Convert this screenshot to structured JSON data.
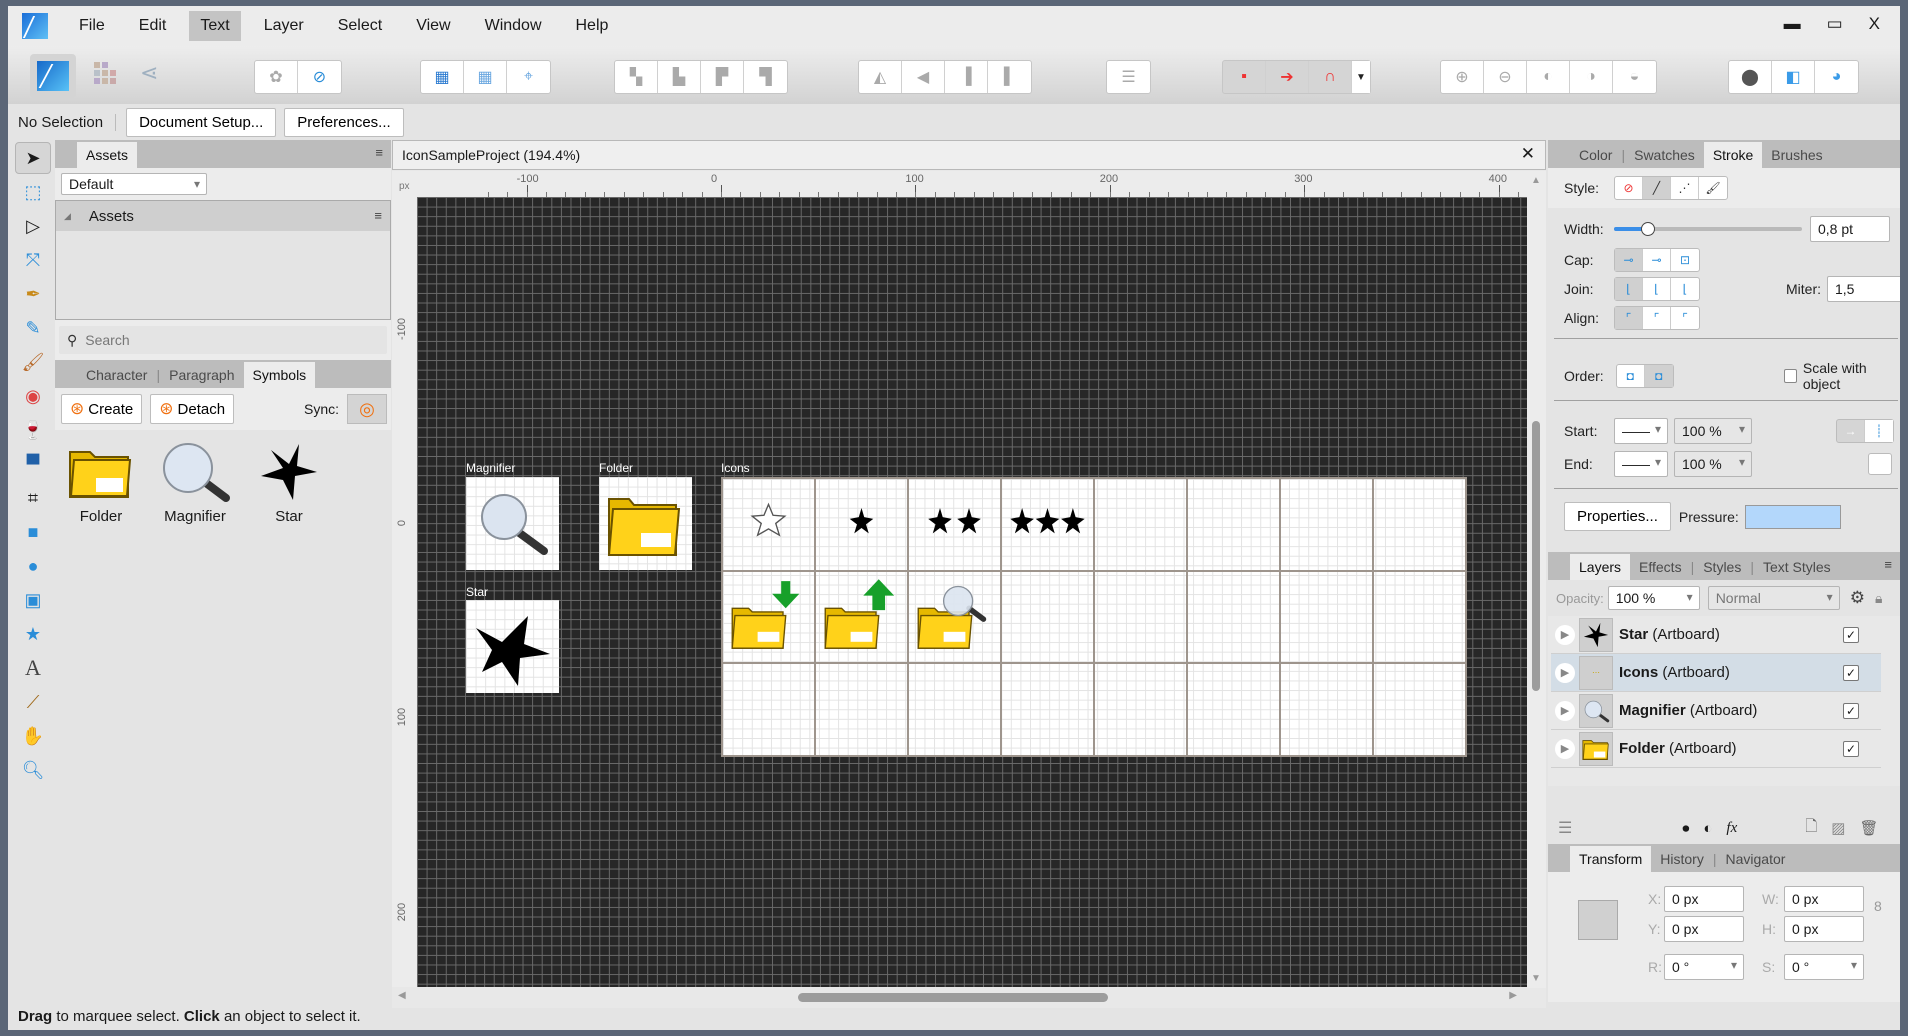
{
  "menubar": {
    "items": [
      "File",
      "Edit",
      "Text",
      "Layer",
      "Select",
      "View",
      "Window",
      "Help"
    ],
    "active": "Text"
  },
  "window_controls": {
    "minimize": "▬",
    "maximize": "▭",
    "close": "X"
  },
  "context_bar": {
    "selection_label": "No Selection",
    "document_setup_label": "Document Setup...",
    "preferences_label": "Preferences..."
  },
  "tools": [
    "move-tool",
    "artboard-tool",
    "node-tool",
    "corner-tool",
    "pen-tool",
    "pencil-tool",
    "vector-brush-tool",
    "fill-tool",
    "transparency-tool",
    "place-image-tool",
    "crop-tool",
    "rectangle-tool",
    "ellipse-tool",
    "rounded-rectangle-tool",
    "star-tool",
    "artistic-text-tool",
    "color-picker-tool",
    "view-tool",
    "zoom-tool"
  ],
  "left_panel": {
    "assets_tab": "Assets",
    "category_select": "Default",
    "assets_group_title": "Assets",
    "search_placeholder": "Search",
    "tabs": [
      "Character",
      "Paragraph",
      "Symbols"
    ],
    "active_tab": "Symbols",
    "create_label": "Create",
    "detach_label": "Detach",
    "sync_label": "Sync:",
    "symbols": [
      {
        "name": "Folder",
        "icon": "folder-icon"
      },
      {
        "name": "Magnifier",
        "icon": "magnifier-icon"
      },
      {
        "name": "Star",
        "icon": "star-icon"
      }
    ]
  },
  "document": {
    "title": "IconSampleProject (194.4%)",
    "ruler_unit": "px",
    "h_ruler_labels": [
      "-100",
      "0",
      "100",
      "200",
      "300",
      "400"
    ],
    "v_ruler_labels": [
      "-100",
      "0",
      "100",
      "200"
    ],
    "artboards": [
      {
        "name": "Magnifier",
        "content": "magnifier-icon"
      },
      {
        "name": "Folder",
        "content": "folder-icon"
      },
      {
        "name": "Star",
        "content": "star-icon"
      },
      {
        "name": "Icons",
        "columns": 8,
        "rows": 3,
        "cells": [
          "star-outline-icon",
          "star-1-icon",
          "star-2-icon",
          "star-3-icon",
          "",
          "",
          "",
          "",
          "folder-download-icon",
          "folder-upload-icon",
          "folder-search-icon",
          "",
          "",
          "",
          "",
          "",
          "",
          "",
          "",
          "",
          "",
          "",
          "",
          ""
        ]
      }
    ]
  },
  "status_bar": {
    "bold1": "Drag",
    "text1": " to marquee select. ",
    "bold2": "Click",
    "text2": " an object to select it."
  },
  "stroke_panel": {
    "tabs": [
      "Color",
      "Swatches",
      "Stroke",
      "Brushes"
    ],
    "active_tab": "Stroke",
    "style_label": "Style:",
    "width_label": "Width:",
    "width_value": "0,8 pt",
    "width_slider_fraction": 0.18,
    "cap_label": "Cap:",
    "join_label": "Join:",
    "miter_label": "Miter:",
    "miter_value": "1,5",
    "align_label": "Align:",
    "order_label": "Order:",
    "scale_with_object_label": "Scale with object",
    "scale_with_object_checked": false,
    "start_label": "Start:",
    "end_label": "End:",
    "start_scale": "100 %",
    "end_scale": "100 %",
    "properties_label": "Properties...",
    "pressure_label": "Pressure:"
  },
  "layers_panel": {
    "tabs": [
      "Layers",
      "Effects",
      "Styles",
      "Text Styles"
    ],
    "active_tab": "Layers",
    "opacity_label": "Opacity:",
    "opacity_value": "100 %",
    "blend_mode": "Normal",
    "layers": [
      {
        "name": "Star",
        "type": " (Artboard)",
        "visible": true,
        "selected": false
      },
      {
        "name": "Icons",
        "type": " (Artboard)",
        "visible": true,
        "selected": true
      },
      {
        "name": "Magnifier",
        "type": " (Artboard)",
        "visible": true,
        "selected": false
      },
      {
        "name": "Folder",
        "type": " (Artboard)",
        "visible": true,
        "selected": false
      }
    ]
  },
  "transform_panel": {
    "tabs": [
      "Transform",
      "History",
      "Navigator"
    ],
    "active_tab": "Transform",
    "x_label": "X:",
    "x_value": "0 px",
    "y_label": "Y:",
    "y_value": "0 px",
    "w_label": "W:",
    "w_value": "0 px",
    "h_label": "H:",
    "h_value": "0 px",
    "r_label": "R:",
    "r_value": "0 °",
    "s_label": "S:",
    "s_value": "0 °"
  },
  "colors": {
    "accent": "#2a8dd8",
    "pressure_fill": "#b3d7fb",
    "selected_layer": "#d3dde6",
    "canvas_bg": "#272727"
  }
}
